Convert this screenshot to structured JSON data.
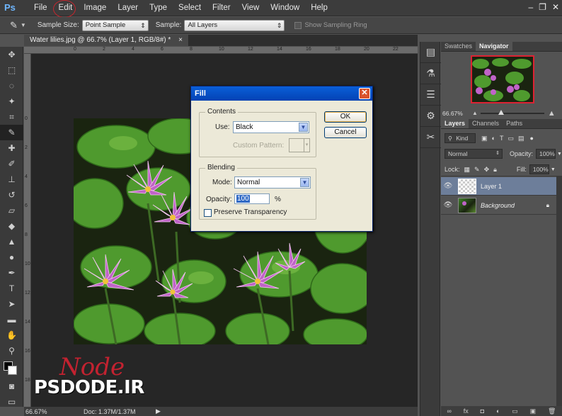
{
  "app": {
    "logo": "Ps"
  },
  "menu": [
    "File",
    "Edit",
    "Image",
    "Layer",
    "Type",
    "Select",
    "Filter",
    "View",
    "Window",
    "Help"
  ],
  "window_buttons": {
    "minimize": "–",
    "restore": "❐",
    "close": "✕"
  },
  "options_bar": {
    "sample_size_label": "Sample Size:",
    "sample_size_value": "Point Sample",
    "sample_label": "Sample:",
    "sample_value": "All Layers",
    "show_ring_label": "Show Sampling Ring"
  },
  "document": {
    "tab_title": "Water lilies.jpg @ 66.7% (Layer 1, RGB/8#) *",
    "tab_close": "×",
    "ruler_h": [
      "0",
      "2",
      "4",
      "6",
      "8",
      "10",
      "12",
      "14",
      "16",
      "18",
      "20",
      "22"
    ],
    "ruler_v": [
      "0",
      "2",
      "4",
      "6",
      "8",
      "10",
      "12",
      "14",
      "16",
      "18"
    ]
  },
  "status": {
    "zoom": "66.67%",
    "doc": "Doc: 1.37M/1.37M",
    "arrow": "▶"
  },
  "fill_dialog": {
    "title": "Fill",
    "close": "✕",
    "contents_label": "Contents",
    "use_label": "Use:",
    "use_value": "Black",
    "custom_pattern_label": "Custom Pattern:",
    "blending_label": "Blending",
    "mode_label": "Mode:",
    "mode_value": "Normal",
    "opacity_label": "Opacity:",
    "opacity_value": "100",
    "opacity_unit": "%",
    "preserve_label": "Preserve Transparency",
    "ok": "OK",
    "cancel": "Cancel"
  },
  "navigator_panel": {
    "tabs": [
      "Swatches",
      "Navigator"
    ],
    "zoom": "66.67%"
  },
  "layers_panel": {
    "tabs": [
      "Layers",
      "Channels",
      "Paths"
    ],
    "kind": "Kind",
    "blend_mode": "Normal",
    "opacity_label": "Opacity:",
    "opacity_value": "100%",
    "lock_label": "Lock:",
    "fill_label": "Fill:",
    "fill_value": "100%",
    "layers": [
      {
        "name": "Layer 1"
      },
      {
        "name": "Background"
      }
    ],
    "bottom_icons": [
      "∞",
      "fx",
      "◘",
      "◐",
      "▭",
      "▣",
      "🗑"
    ]
  },
  "watermark": {
    "text": "PSDODE.IR",
    "signature": "Node"
  },
  "colors": {
    "photoshop_bg": "#535353",
    "dialog_title": "#0a5fd8",
    "accent_red": "#c6262e"
  }
}
